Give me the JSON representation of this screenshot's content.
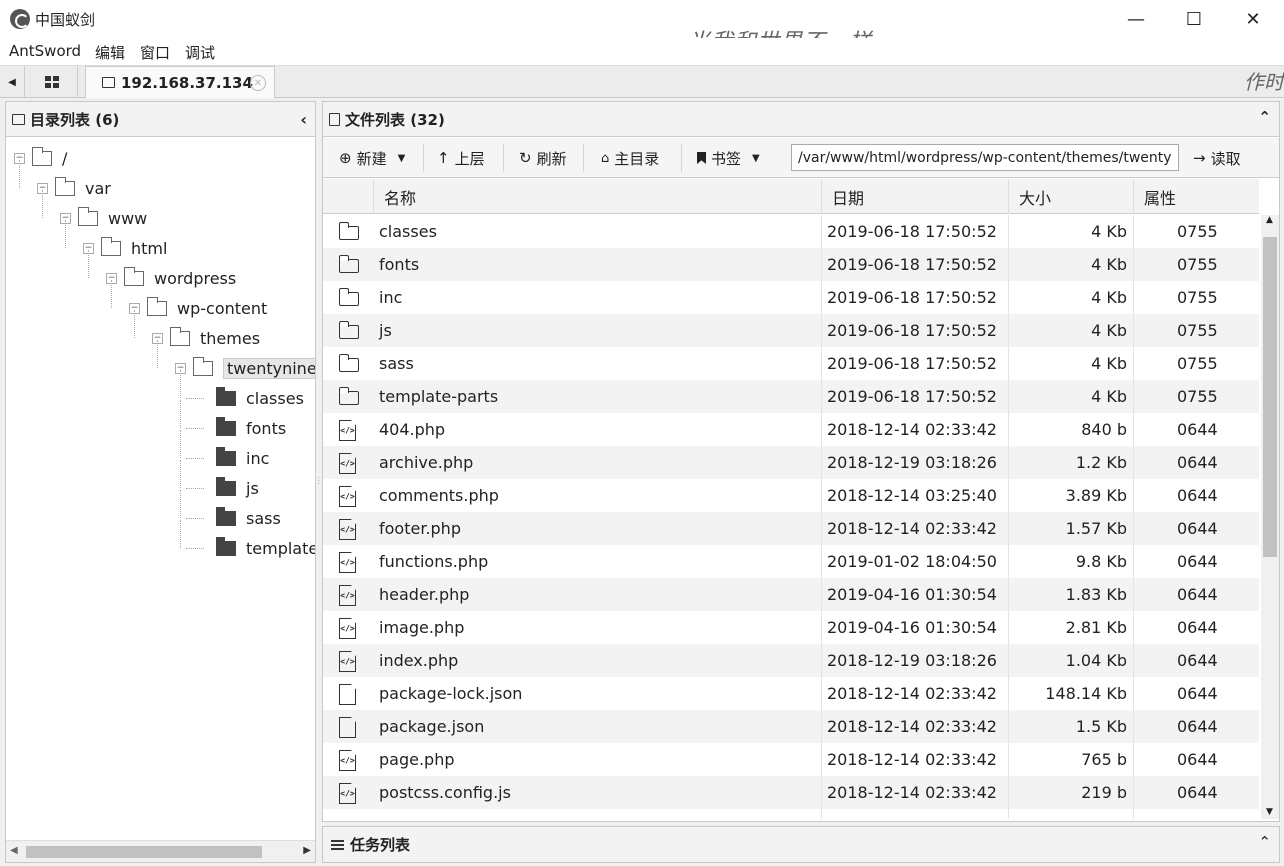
{
  "app": {
    "title": "中国蚁剑",
    "watermark": "当我和世界不一样"
  },
  "window_buttons": {
    "minimize": "—",
    "maximize": "☐",
    "close": "✕"
  },
  "menu": [
    "AntSword",
    "编辑",
    "窗口",
    "调试"
  ],
  "tabs": {
    "host_tab": "192.168.37.134",
    "right_overflow_text": "作时"
  },
  "dir_panel": {
    "title": "目录列表 (6)",
    "tree": [
      {
        "label": "/",
        "depth": 0,
        "type": "open"
      },
      {
        "label": "var",
        "depth": 1,
        "type": "open"
      },
      {
        "label": "www",
        "depth": 2,
        "type": "open"
      },
      {
        "label": "html",
        "depth": 3,
        "type": "open"
      },
      {
        "label": "wordpress",
        "depth": 4,
        "type": "open"
      },
      {
        "label": "wp-content",
        "depth": 5,
        "type": "open"
      },
      {
        "label": "themes",
        "depth": 6,
        "type": "open"
      },
      {
        "label": "twentyninetee",
        "depth": 7,
        "type": "open",
        "selected": true
      },
      {
        "label": "classes",
        "depth": 8,
        "type": "closed"
      },
      {
        "label": "fonts",
        "depth": 8,
        "type": "closed"
      },
      {
        "label": "inc",
        "depth": 8,
        "type": "closed"
      },
      {
        "label": "js",
        "depth": 8,
        "type": "closed"
      },
      {
        "label": "sass",
        "depth": 8,
        "type": "closed"
      },
      {
        "label": "template-p",
        "depth": 8,
        "type": "closed"
      }
    ]
  },
  "file_panel": {
    "title": "文件列表 (32)",
    "toolbar": {
      "new": "新建",
      "up": "上层",
      "refresh": "刷新",
      "home": "主目录",
      "bookmark": "书签",
      "path": "/var/www/html/wordpress/wp-content/themes/twentynineteen",
      "read": "读取"
    },
    "columns": [
      "名称",
      "日期",
      "大小",
      "属性"
    ],
    "rows": [
      {
        "icon": "folder",
        "name": "classes",
        "date": "2019-06-18 17:50:52",
        "size": "4 Kb",
        "attr": "0755"
      },
      {
        "icon": "folder",
        "name": "fonts",
        "date": "2019-06-18 17:50:52",
        "size": "4 Kb",
        "attr": "0755"
      },
      {
        "icon": "folder",
        "name": "inc",
        "date": "2019-06-18 17:50:52",
        "size": "4 Kb",
        "attr": "0755"
      },
      {
        "icon": "folder",
        "name": "js",
        "date": "2019-06-18 17:50:52",
        "size": "4 Kb",
        "attr": "0755"
      },
      {
        "icon": "folder",
        "name": "sass",
        "date": "2019-06-18 17:50:52",
        "size": "4 Kb",
        "attr": "0755"
      },
      {
        "icon": "folder",
        "name": "template-parts",
        "date": "2019-06-18 17:50:52",
        "size": "4 Kb",
        "attr": "0755"
      },
      {
        "icon": "code",
        "name": "404.php",
        "date": "2018-12-14 02:33:42",
        "size": "840 b",
        "attr": "0644"
      },
      {
        "icon": "code",
        "name": "archive.php",
        "date": "2018-12-19 03:18:26",
        "size": "1.2 Kb",
        "attr": "0644"
      },
      {
        "icon": "code",
        "name": "comments.php",
        "date": "2018-12-14 03:25:40",
        "size": "3.89 Kb",
        "attr": "0644"
      },
      {
        "icon": "code",
        "name": "footer.php",
        "date": "2018-12-14 02:33:42",
        "size": "1.57 Kb",
        "attr": "0644"
      },
      {
        "icon": "code",
        "name": "functions.php",
        "date": "2019-01-02 18:04:50",
        "size": "9.8 Kb",
        "attr": "0644"
      },
      {
        "icon": "code",
        "name": "header.php",
        "date": "2019-04-16 01:30:54",
        "size": "1.83 Kb",
        "attr": "0644"
      },
      {
        "icon": "code",
        "name": "image.php",
        "date": "2019-04-16 01:30:54",
        "size": "2.81 Kb",
        "attr": "0644"
      },
      {
        "icon": "code",
        "name": "index.php",
        "date": "2018-12-19 03:18:26",
        "size": "1.04 Kb",
        "attr": "0644"
      },
      {
        "icon": "file",
        "name": "package-lock.json",
        "date": "2018-12-14 02:33:42",
        "size": "148.14 Kb",
        "attr": "0644"
      },
      {
        "icon": "file",
        "name": "package.json",
        "date": "2018-12-14 02:33:42",
        "size": "1.5 Kb",
        "attr": "0644"
      },
      {
        "icon": "code",
        "name": "page.php",
        "date": "2018-12-14 02:33:42",
        "size": "765 b",
        "attr": "0644"
      },
      {
        "icon": "code",
        "name": "postcss.config.js",
        "date": "2018-12-14 02:33:42",
        "size": "219 b",
        "attr": "0644"
      }
    ]
  },
  "task_panel": {
    "title": "任务列表"
  }
}
